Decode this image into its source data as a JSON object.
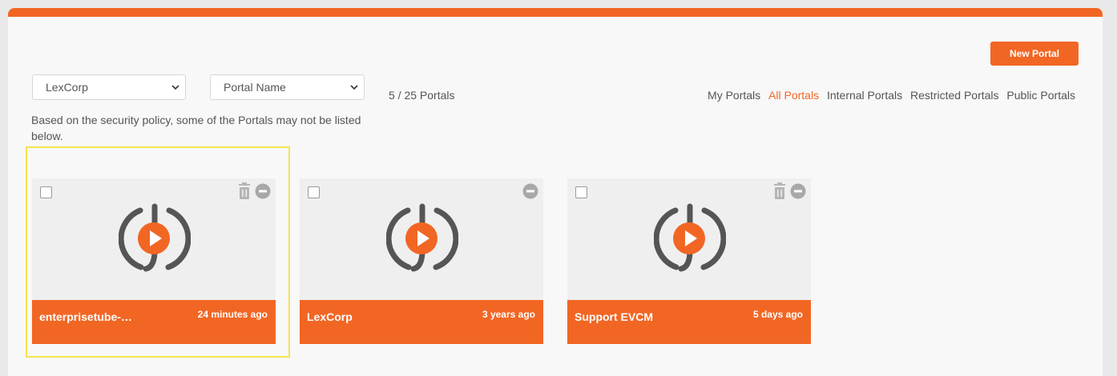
{
  "header": {
    "new_portal_label": "New Portal"
  },
  "filters_bar": {
    "company_select": "LexCorp",
    "sort_select": "Portal Name",
    "portal_count": "5 / 25 Portals",
    "tabs": [
      {
        "label": "My Portals",
        "active": false
      },
      {
        "label": "All Portals",
        "active": true
      },
      {
        "label": "Internal Portals",
        "active": false
      },
      {
        "label": "Restricted Portals",
        "active": false
      },
      {
        "label": "Public Portals",
        "active": false
      }
    ]
  },
  "notice": "Based on the security policy, some of the Portals may not be listed below.",
  "cards": [
    {
      "title": "enterprisetube-…",
      "time": "24 minutes ago",
      "has_trash": true
    },
    {
      "title": "LexCorp",
      "time": "3 years ago",
      "has_trash": false
    },
    {
      "title": "Support EVCM",
      "time": "5 days ago",
      "has_trash": true
    }
  ],
  "colors": {
    "accent": "#f26624",
    "highlight": "#f5e34f",
    "logo_gray": "#555555"
  },
  "icons": [
    "chevron-down-icon",
    "trash-icon",
    "minus-circle-icon",
    "portal-logo-icon"
  ]
}
